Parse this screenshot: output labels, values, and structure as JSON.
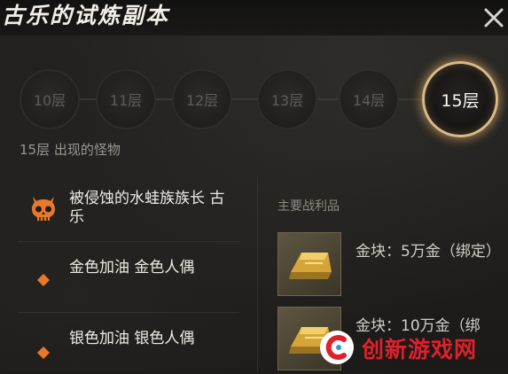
{
  "header": {
    "title": "古乐的试炼副本"
  },
  "floors": [
    {
      "label": "10层",
      "active": false
    },
    {
      "label": "11层",
      "active": false
    },
    {
      "label": "12层",
      "active": false
    },
    {
      "label": "13层",
      "active": false
    },
    {
      "label": "14层",
      "active": false
    },
    {
      "label": "15层",
      "active": true
    }
  ],
  "monsters": {
    "section_title": "15层 出现的怪物",
    "items": [
      {
        "label": "被侵蚀的水蛙族族长 古乐",
        "icon": "boss-skull-icon"
      },
      {
        "label": "金色加油 金色人偶",
        "icon": "orange-diamond-icon"
      },
      {
        "label": "银色加油 银色人偶",
        "icon": "orange-diamond-icon"
      }
    ]
  },
  "loot": {
    "title": "主要战利品",
    "items": [
      {
        "label": "金块：5万金（绑定）",
        "icon": "gold-bar-icon"
      },
      {
        "label": "金块：10万金（绑",
        "icon": "gold-bar-icon"
      }
    ]
  },
  "watermark": {
    "text": "创新游戏网"
  },
  "colors": {
    "accent_gold": "#d9b98a",
    "boss_orange": "#e8792a",
    "diamond_orange": "#e8792a",
    "watermark_red": "#e0202a"
  }
}
